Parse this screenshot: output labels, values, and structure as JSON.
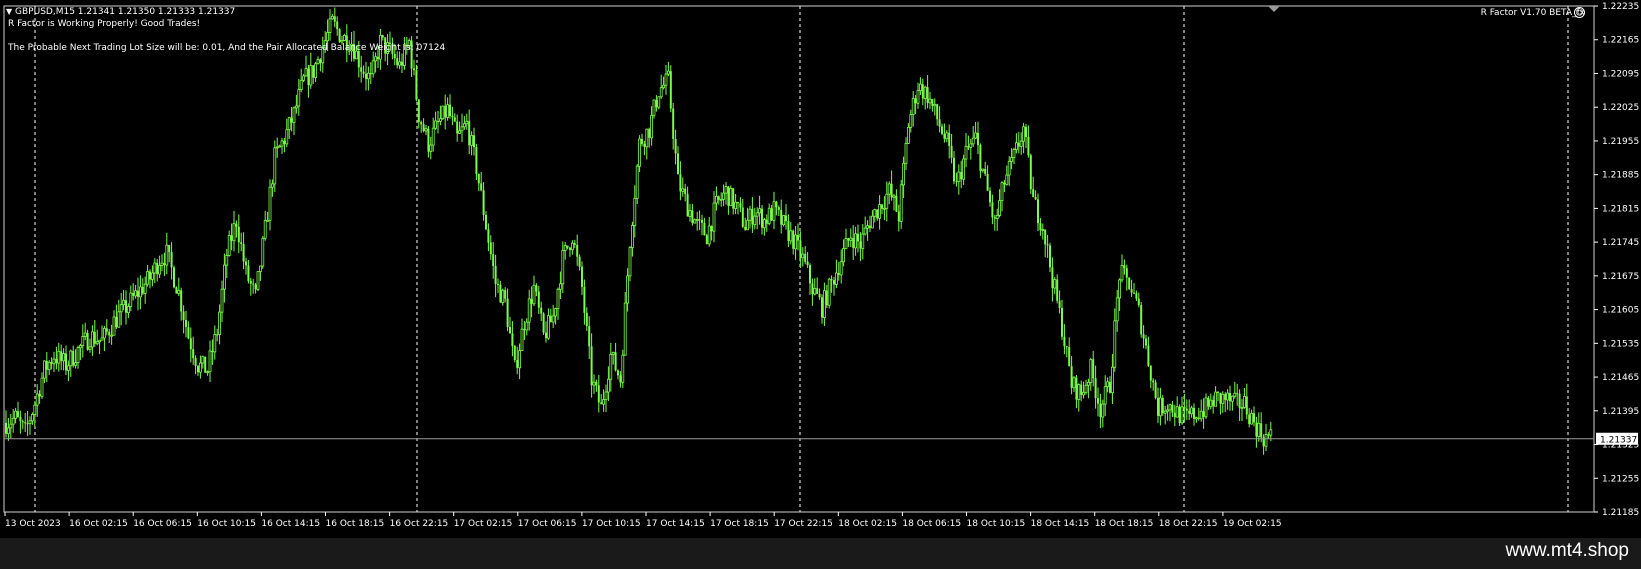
{
  "header": {
    "symbol_line": "GBPUSD,M15  1.21341 1.21350 1.21333 1.21337",
    "status_text": "R Factor is Working Properly! Good Trades!",
    "lot_text": "The Probable Next Trading Lot Size will be: 0.01, And the Pair Allocated Balance Weight is: 07124",
    "ea_label": "R Factor V1.70 BETA_fx"
  },
  "colors": {
    "background": "#000000",
    "candle": "#7CFC4A",
    "grid": "#ffffff",
    "axis_text": "#ffffff",
    "price_line": "#9a9a9a"
  },
  "chart_data": {
    "type": "candlestick",
    "symbol": "GBPUSD",
    "timeframe": "M15",
    "current_price": "1.21337",
    "y_ticks": [
      "1.22235",
      "1.22165",
      "1.22095",
      "1.22025",
      "1.21955",
      "1.21885",
      "1.21815",
      "1.21745",
      "1.21675",
      "1.21605",
      "1.21535",
      "1.21465",
      "1.21395",
      "1.21325",
      "1.21255",
      "1.21185"
    ],
    "ylim": [
      1.21185,
      1.22235
    ],
    "x_ticks": [
      "13 Oct 2023",
      "16 Oct 02:15",
      "16 Oct 06:15",
      "16 Oct 10:15",
      "16 Oct 14:15",
      "16 Oct 18:15",
      "16 Oct 22:15",
      "17 Oct 02:15",
      "17 Oct 06:15",
      "17 Oct 10:15",
      "17 Oct 14:15",
      "17 Oct 18:15",
      "17 Oct 22:15",
      "18 Oct 02:15",
      "18 Oct 06:15",
      "18 Oct 10:15",
      "18 Oct 14:15",
      "18 Oct 18:15",
      "18 Oct 22:15",
      "19 Oct 02:15"
    ],
    "grid_day_separators": [
      "16 Oct",
      "17 Oct",
      "18 Oct",
      "19 Oct"
    ],
    "close_path": [
      [
        0,
        1.2137
      ],
      [
        4,
        1.2138
      ],
      [
        8,
        1.2135
      ],
      [
        12,
        1.2141
      ],
      [
        16,
        1.2148
      ],
      [
        20,
        1.2151
      ],
      [
        25,
        1.2149
      ],
      [
        30,
        1.2152
      ],
      [
        35,
        1.2155
      ],
      [
        40,
        1.2154
      ],
      [
        45,
        1.2158
      ],
      [
        50,
        1.2161
      ],
      [
        55,
        1.2164
      ],
      [
        60,
        1.2167
      ],
      [
        64,
        1.2171
      ],
      [
        67,
        1.2172
      ],
      [
        72,
        1.2164
      ],
      [
        76,
        1.2155
      ],
      [
        80,
        1.2149
      ],
      [
        84,
        1.2148
      ],
      [
        88,
        1.2156
      ],
      [
        92,
        1.2172
      ],
      [
        96,
        1.2179
      ],
      [
        100,
        1.2168
      ],
      [
        104,
        1.2163
      ],
      [
        108,
        1.2177
      ],
      [
        112,
        1.2192
      ],
      [
        116,
        1.2196
      ],
      [
        120,
        1.2201
      ],
      [
        124,
        1.2208
      ],
      [
        128,
        1.221
      ],
      [
        132,
        1.2215
      ],
      [
        136,
        1.222
      ],
      [
        140,
        1.2217
      ],
      [
        144,
        1.2216
      ],
      [
        148,
        1.2211
      ],
      [
        152,
        1.2208
      ],
      [
        156,
        1.2216
      ],
      [
        160,
        1.2214
      ],
      [
        164,
        1.2211
      ],
      [
        168,
        1.2216
      ],
      [
        172,
        1.2201
      ],
      [
        176,
        1.2195
      ],
      [
        180,
        1.2199
      ],
      [
        184,
        1.2202
      ],
      [
        188,
        1.2196
      ],
      [
        192,
        1.2199
      ],
      [
        196,
        1.219
      ],
      [
        200,
        1.2178
      ],
      [
        204,
        1.2166
      ],
      [
        208,
        1.2162
      ],
      [
        212,
        1.2148
      ],
      [
        216,
        1.2158
      ],
      [
        220,
        1.2165
      ],
      [
        224,
        1.2155
      ],
      [
        228,
        1.2159
      ],
      [
        232,
        1.2171
      ],
      [
        236,
        1.2176
      ],
      [
        240,
        1.2165
      ],
      [
        244,
        1.2146
      ],
      [
        248,
        1.214
      ],
      [
        252,
        1.2151
      ],
      [
        256,
        1.2146
      ],
      [
        260,
        1.2175
      ],
      [
        264,
        1.2195
      ],
      [
        268,
        1.2198
      ],
      [
        272,
        1.2206
      ],
      [
        276,
        1.2208
      ],
      [
        280,
        1.2187
      ],
      [
        284,
        1.2182
      ],
      [
        288,
        1.2178
      ],
      [
        292,
        1.2176
      ],
      [
        296,
        1.2182
      ],
      [
        300,
        1.2185
      ],
      [
        304,
        1.2182
      ],
      [
        308,
        1.2178
      ],
      [
        312,
        1.2181
      ],
      [
        316,
        1.2179
      ],
      [
        320,
        1.2181
      ],
      [
        324,
        1.2178
      ],
      [
        328,
        1.2175
      ],
      [
        332,
        1.2171
      ],
      [
        336,
        1.2165
      ],
      [
        340,
        1.2161
      ],
      [
        344,
        1.2166
      ],
      [
        348,
        1.2171
      ],
      [
        352,
        1.2176
      ],
      [
        356,
        1.2174
      ],
      [
        360,
        1.2179
      ],
      [
        364,
        1.2182
      ],
      [
        368,
        1.2185
      ],
      [
        372,
        1.218
      ],
      [
        376,
        1.2199
      ],
      [
        380,
        1.2207
      ],
      [
        384,
        1.2205
      ],
      [
        388,
        1.22
      ],
      [
        392,
        1.2195
      ],
      [
        396,
        1.2186
      ],
      [
        400,
        1.2193
      ],
      [
        404,
        1.2196
      ],
      [
        408,
        1.2187
      ],
      [
        412,
        1.2178
      ],
      [
        416,
        1.2187
      ],
      [
        420,
        1.2192
      ],
      [
        424,
        1.2198
      ],
      [
        428,
        1.2183
      ],
      [
        432,
        1.2178
      ],
      [
        436,
        1.2167
      ],
      [
        440,
        1.2157
      ],
      [
        444,
        1.2145
      ],
      [
        448,
        1.2143
      ],
      [
        452,
        1.2148
      ],
      [
        456,
        1.214
      ],
      [
        460,
        1.2145
      ],
      [
        464,
        1.2168
      ],
      [
        468,
        1.2166
      ],
      [
        472,
        1.216
      ],
      [
        476,
        1.215
      ],
      [
        480,
        1.214
      ],
      [
        484,
        1.2141
      ],
      [
        488,
        1.2139
      ],
      [
        492,
        1.2138
      ],
      [
        496,
        1.2139
      ],
      [
        500,
        1.214
      ],
      [
        504,
        1.2142
      ],
      [
        508,
        1.2142
      ],
      [
        512,
        1.2141
      ],
      [
        516,
        1.2141
      ],
      [
        520,
        1.2137
      ],
      [
        524,
        1.2134
      ],
      [
        527,
        1.2134
      ]
    ]
  },
  "footer": {
    "watermark": "www.mt4.shop"
  }
}
